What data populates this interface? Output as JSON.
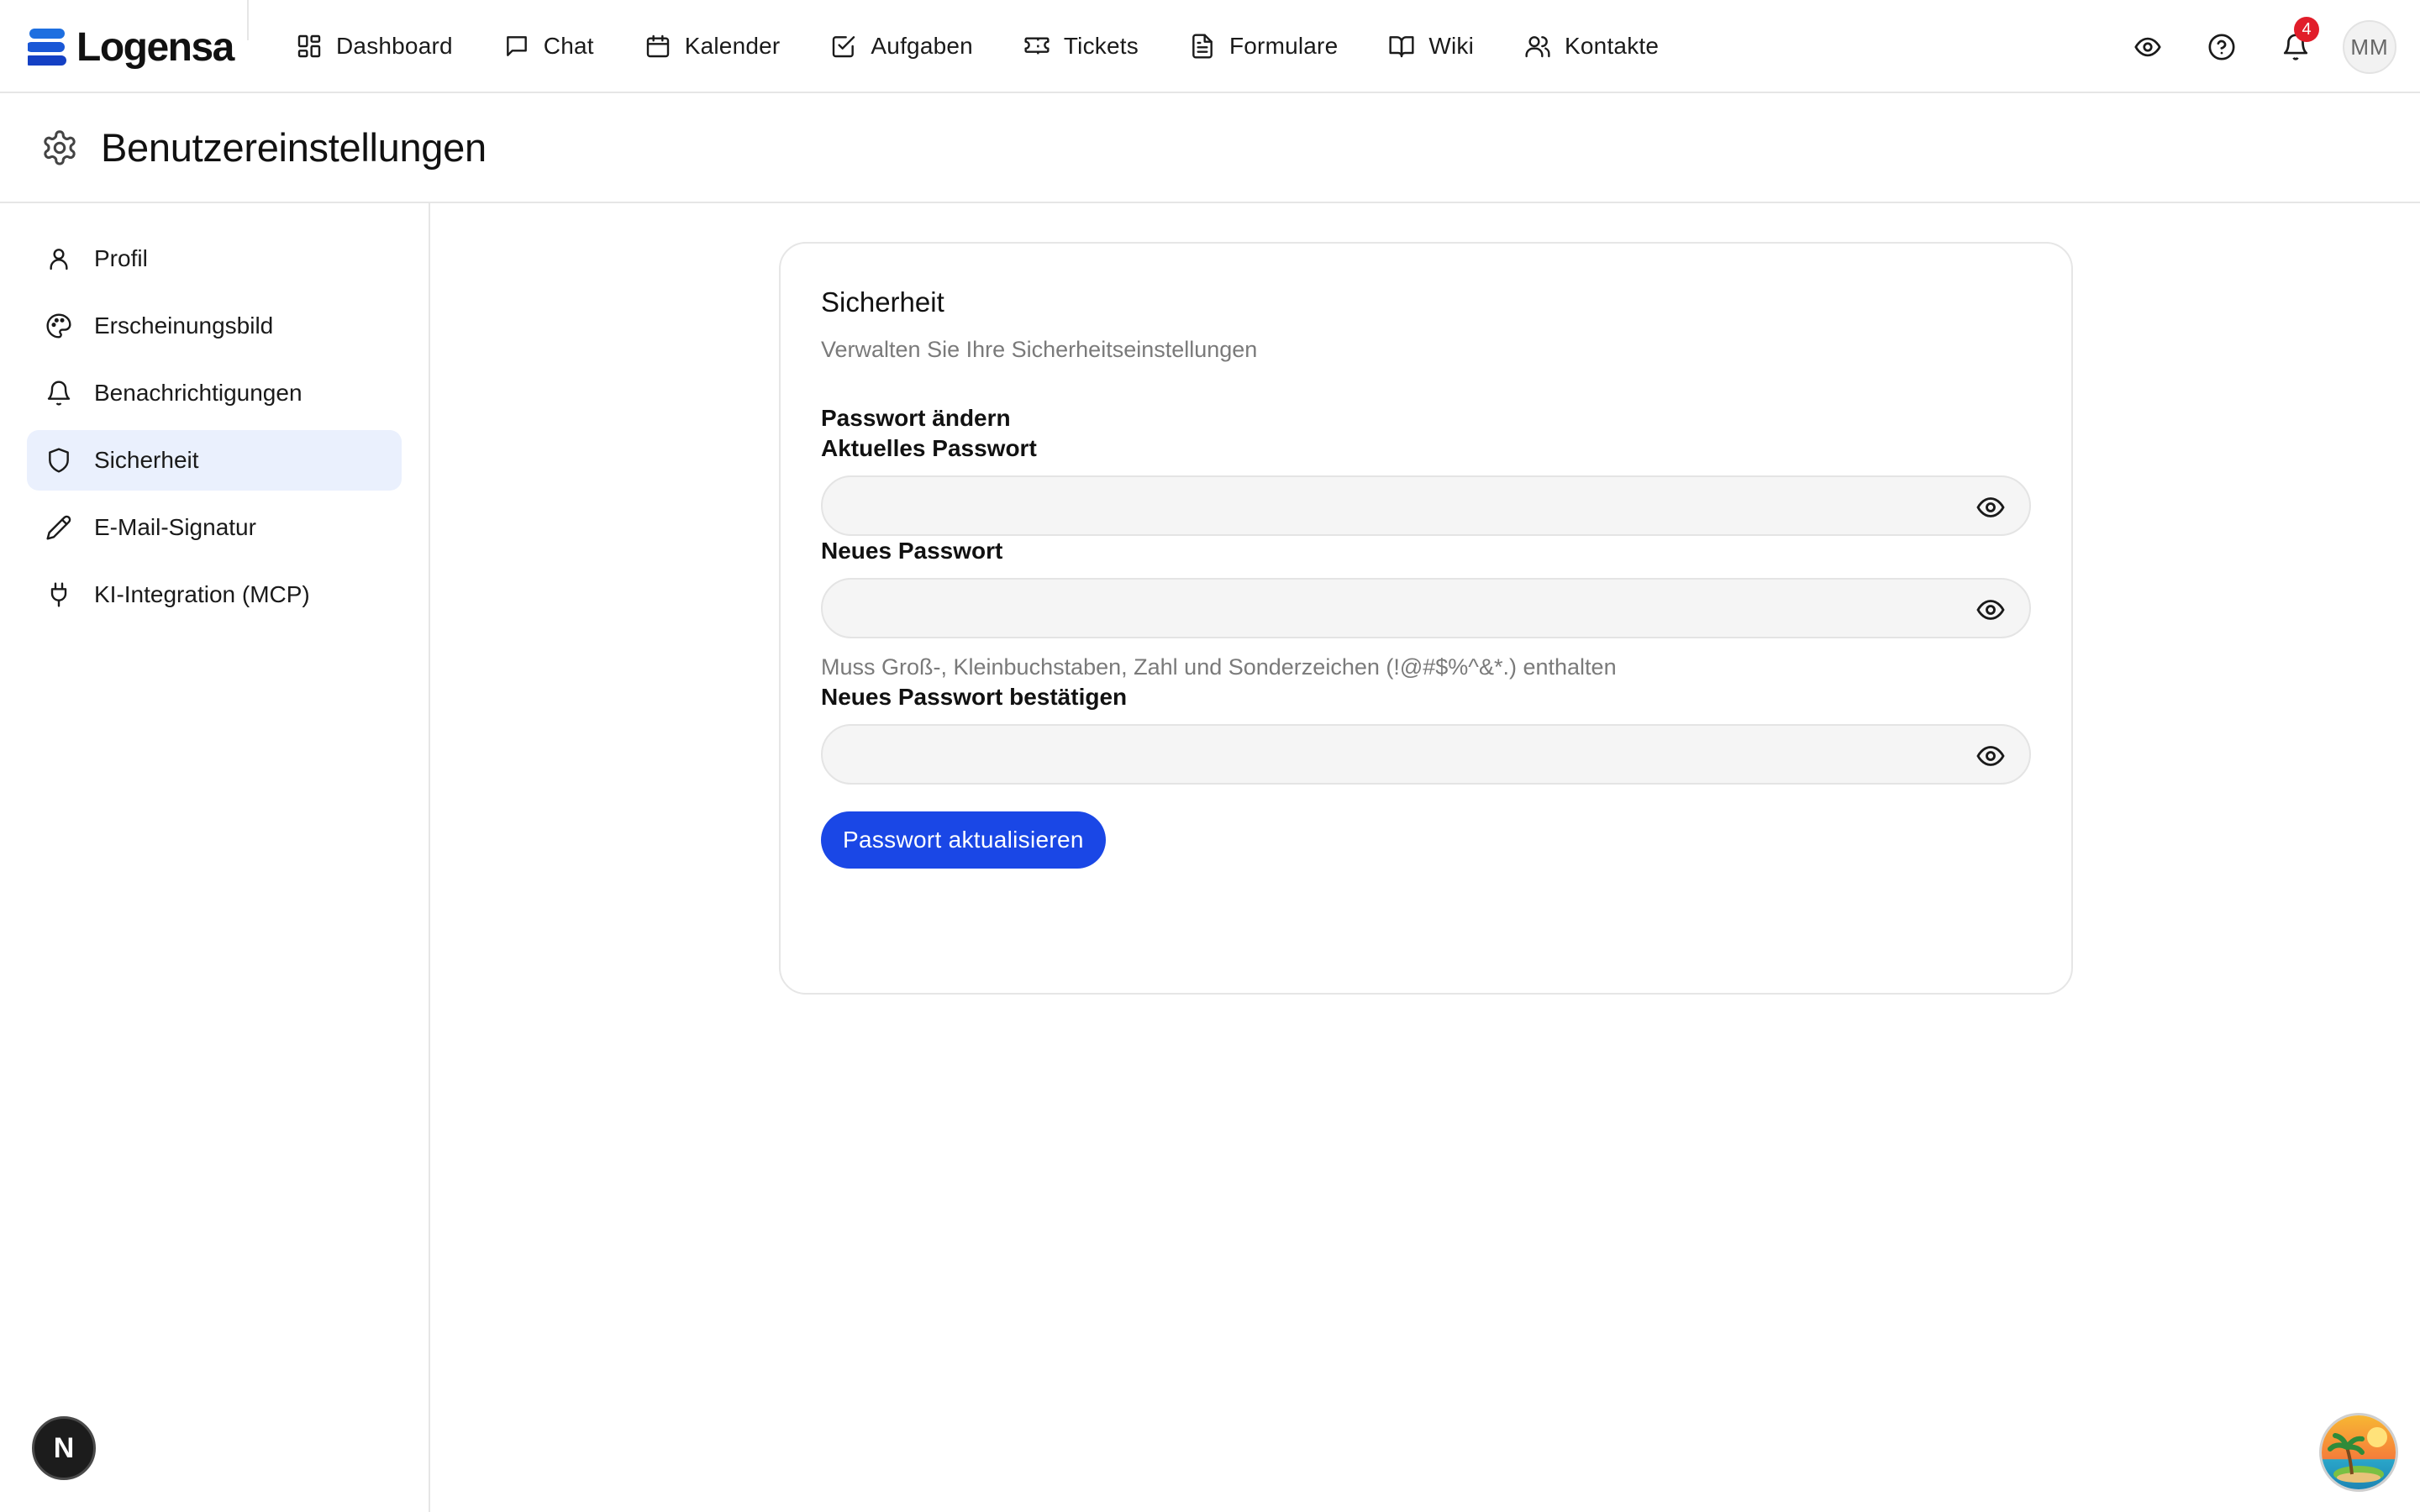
{
  "app": {
    "logo_text": "Logensa",
    "accent_color": "#1a47e6",
    "logo_color": "#1e6fe0"
  },
  "nav": {
    "items": [
      {
        "label": "Dashboard",
        "icon": "dashboard-icon"
      },
      {
        "label": "Chat",
        "icon": "chat-icon"
      },
      {
        "label": "Kalender",
        "icon": "calendar-icon"
      },
      {
        "label": "Aufgaben",
        "icon": "task-icon"
      },
      {
        "label": "Tickets",
        "icon": "ticket-icon"
      },
      {
        "label": "Formulare",
        "icon": "form-icon"
      },
      {
        "label": "Wiki",
        "icon": "book-icon"
      },
      {
        "label": "Kontakte",
        "icon": "contacts-icon"
      }
    ]
  },
  "topbar": {
    "notification_count": "4",
    "avatar_initials": "MM"
  },
  "page": {
    "title": "Benutzereinstellungen"
  },
  "sidebar": {
    "items": [
      {
        "label": "Profil",
        "icon": "user-icon"
      },
      {
        "label": "Erscheinungsbild",
        "icon": "palette-icon"
      },
      {
        "label": "Benachrichtigungen",
        "icon": "bell-icon"
      },
      {
        "label": "Sicherheit",
        "icon": "shield-icon",
        "active": true
      },
      {
        "label": "E-Mail-Signatur",
        "icon": "pen-icon"
      },
      {
        "label": "KI-Integration (MCP)",
        "icon": "plug-icon"
      }
    ]
  },
  "security": {
    "title": "Sicherheit",
    "subtitle": "Verwalten Sie Ihre Sicherheitseinstellungen",
    "section_title": "Passwort ändern",
    "current_password": {
      "label": "Aktuelles Passwort",
      "value": "",
      "placeholder": ""
    },
    "new_password": {
      "label": "Neues Passwort",
      "value": "",
      "placeholder": ""
    },
    "password_hint": "Muss Groß-, Kleinbuchstaben, Zahl und Sonderzeichen (!@#$%^&*.) enthalten",
    "confirm_password": {
      "label": "Neues Passwort bestätigen",
      "value": "",
      "placeholder": ""
    },
    "submit_label": "Passwort aktualisieren"
  },
  "floating": {
    "dev_badge_letter": "N"
  }
}
